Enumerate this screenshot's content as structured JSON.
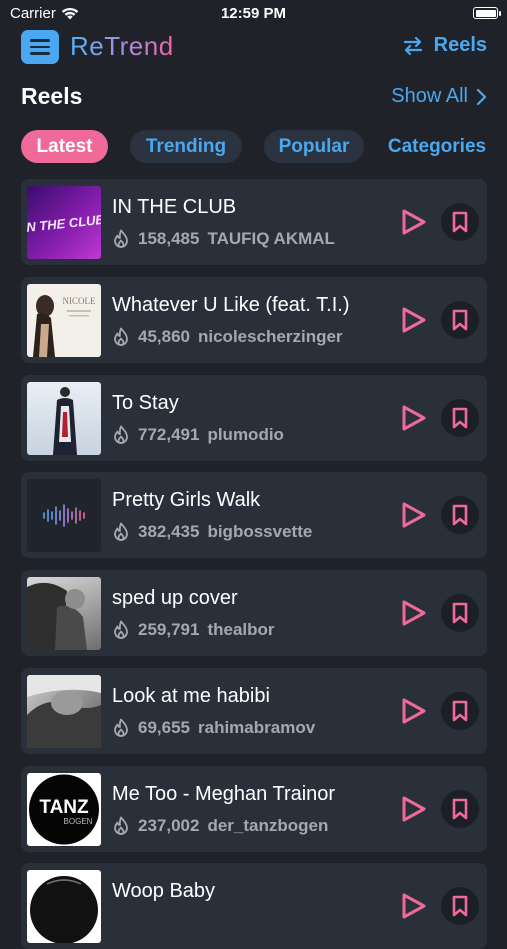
{
  "status_bar": {
    "carrier": "Carrier",
    "time": "12:59 PM"
  },
  "header": {
    "brand": "ReTrend",
    "reels_label": "Reels"
  },
  "section": {
    "title": "Reels",
    "show_all": "Show All"
  },
  "tabs": [
    {
      "label": "Latest",
      "active": true
    },
    {
      "label": "Trending",
      "active": false
    },
    {
      "label": "Popular",
      "active": false
    },
    {
      "label": "Categories",
      "active": false
    }
  ],
  "colors": {
    "accent_blue": "#4aa8f0",
    "accent_pink": "#ef6a99",
    "card": "#2a303a",
    "background": "#1f2329"
  },
  "reels": [
    {
      "title": "IN THE CLUB",
      "views": "158,485",
      "author": "TAUFIQ AKMAL",
      "thumb_text": "IN THE CLUB"
    },
    {
      "title": "Whatever U Like (feat. T.I.)",
      "views": "45,860",
      "author": "nicolescherzinger",
      "thumb_text": "NICOLE"
    },
    {
      "title": "To Stay",
      "views": "772,491",
      "author": "plumodio"
    },
    {
      "title": "Pretty Girls Walk",
      "views": "382,435",
      "author": "bigbossvette"
    },
    {
      "title": "sped up cover",
      "views": "259,791",
      "author": "thealbor"
    },
    {
      "title": "Look at me habibi",
      "views": "69,655",
      "author": "rahimabramov"
    },
    {
      "title": "Me Too - Meghan Trainor",
      "views": "237,002",
      "author": "der_tanzbogen",
      "thumb_text": "TANZ",
      "thumb_subtext": "BOGEN"
    },
    {
      "title": "Woop Baby",
      "views": "",
      "author": ""
    }
  ]
}
